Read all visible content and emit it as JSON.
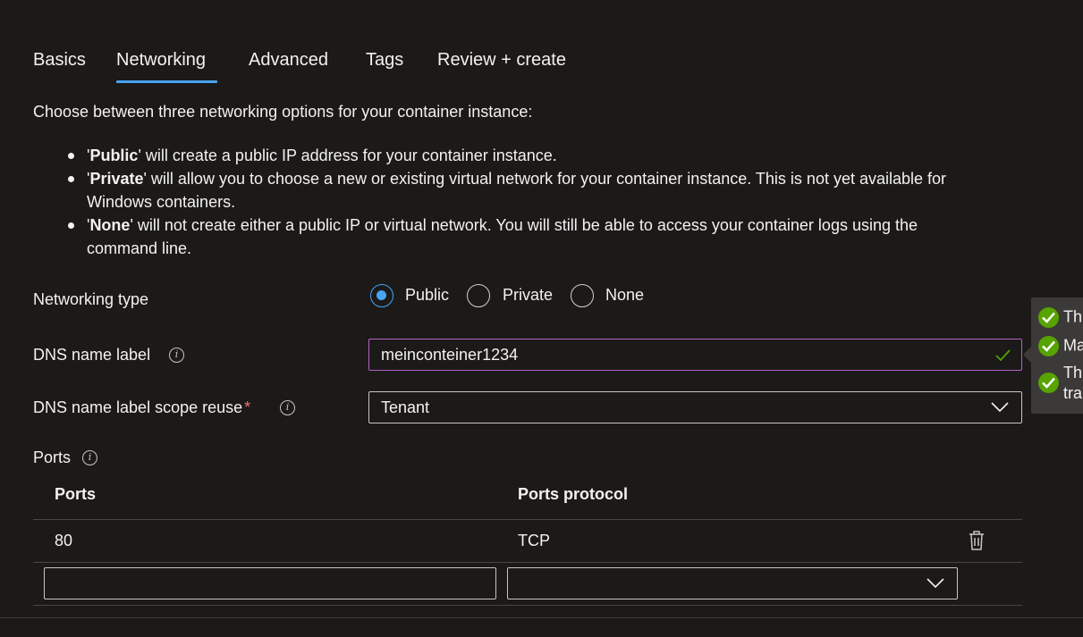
{
  "tabs": [
    {
      "label": "Basics",
      "active": false
    },
    {
      "label": "Networking",
      "active": true
    },
    {
      "label": "Advanced",
      "active": false
    },
    {
      "label": "Tags",
      "active": false
    },
    {
      "label": "Review + create",
      "active": false
    }
  ],
  "intro": "Choose between three networking options for your container instance:",
  "bullets": [
    {
      "bold": "Public",
      "line1": "' will create a public IP address for your container instance.",
      "line2": ""
    },
    {
      "bold": "Private",
      "line1": "' will allow you to choose a new or existing virtual network for your container instance. This is not yet available for",
      "line2": "Windows containers."
    },
    {
      "bold": "None",
      "line1": "' will not create either a public IP or virtual network. You will still be able to access your container logs using the",
      "line2": "command line."
    }
  ],
  "networking_type": {
    "label": "Networking type",
    "options": [
      {
        "label": "Public",
        "selected": true
      },
      {
        "label": "Private",
        "selected": false
      },
      {
        "label": "None",
        "selected": false
      }
    ]
  },
  "dns_label": {
    "label": "DNS name label",
    "value": "meinconteiner1234"
  },
  "dns_scope": {
    "label": "DNS name label scope reuse",
    "required_mark": "*",
    "value": "Tenant"
  },
  "tooltip": {
    "rows": [
      "Th",
      "Ma",
      "Th",
      "tra"
    ]
  },
  "ports": {
    "label": "Ports",
    "headers": [
      "Ports",
      "Ports protocol"
    ],
    "rows": [
      {
        "port": "80",
        "protocol": "TCP"
      }
    ],
    "new_port": "",
    "new_protocol": ""
  },
  "colors": {
    "accent": "#4aa3f0",
    "valid_border": "#b85ec9",
    "success": "#57a300",
    "required": "#f1707b"
  }
}
